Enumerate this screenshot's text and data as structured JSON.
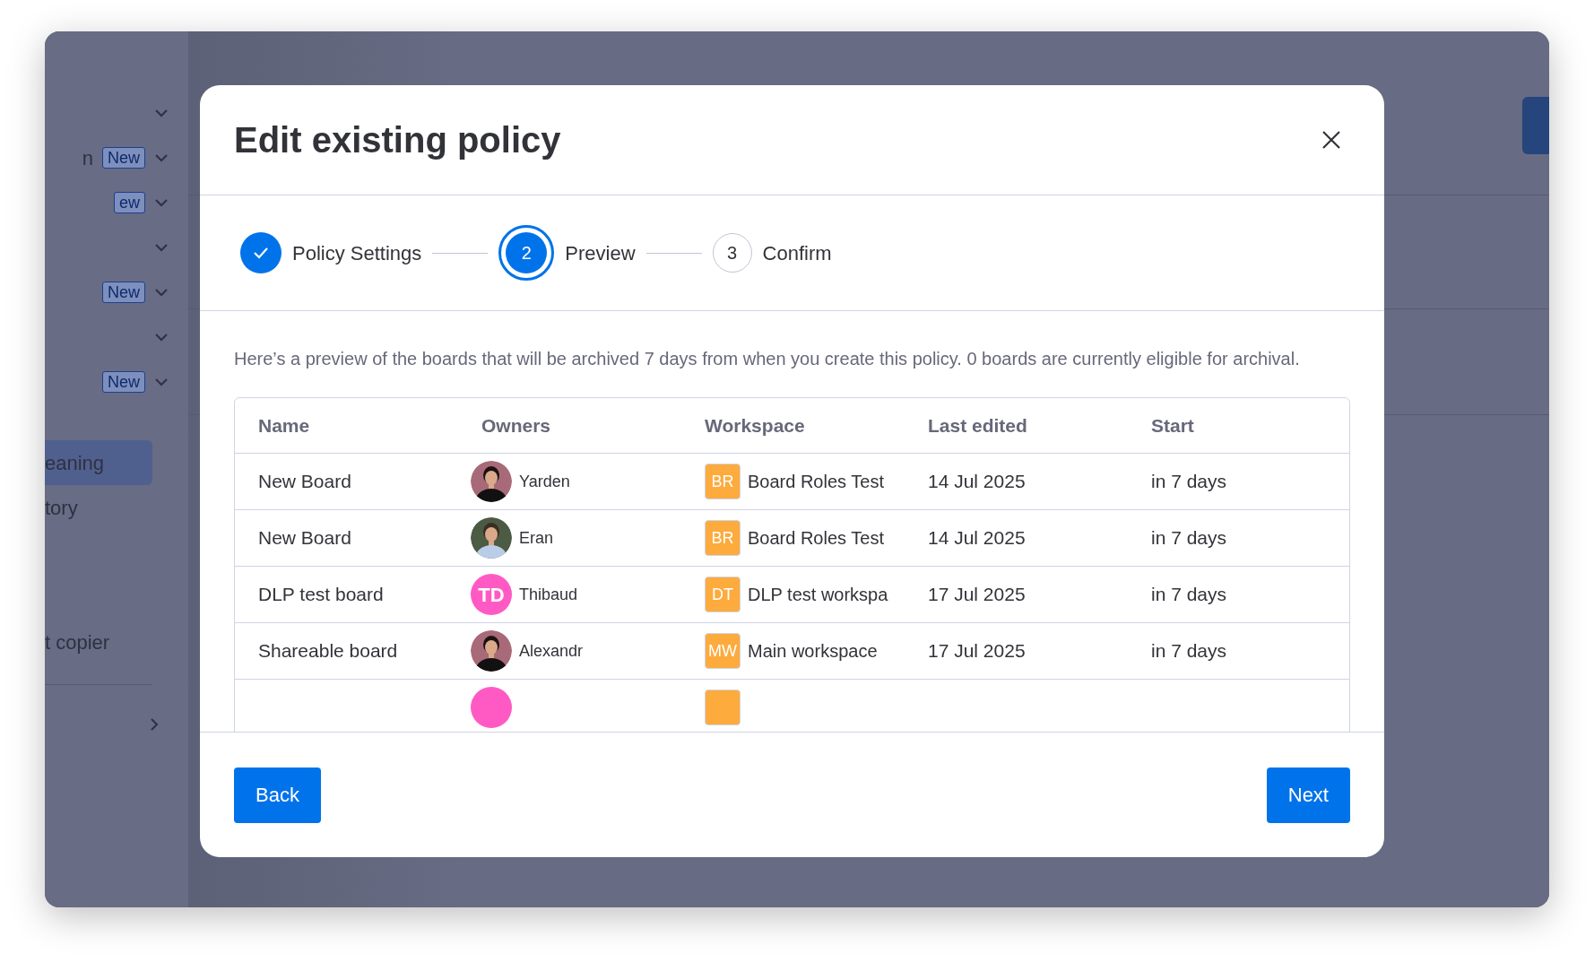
{
  "background": {
    "sections": [
      {
        "expanded": false
      },
      {
        "label": "n",
        "badge": "New",
        "expanded": false
      },
      {
        "badge": "ew",
        "expanded": false
      },
      {
        "expanded": false
      },
      {
        "badge": "New",
        "expanded": false
      },
      {
        "expanded": false
      },
      {
        "badge": "New",
        "expanded": false
      }
    ],
    "items": [
      {
        "label": "eaning",
        "selected": true
      },
      {
        "label": "tory",
        "selected": false
      },
      {
        "label": "t copier",
        "selected": false
      }
    ]
  },
  "dialog": {
    "title": "Edit existing policy",
    "steps": [
      {
        "label": "Policy Settings",
        "kind": "done"
      },
      {
        "number": "2",
        "label": "Preview",
        "kind": "current"
      },
      {
        "number": "3",
        "label": "Confirm",
        "kind": "upcoming"
      }
    ],
    "description": "Here’s a preview of the boards that will be archived 7 days from when you create this policy. 0 boards are currently eligible for archival.",
    "table": {
      "columns": [
        "Name",
        "Owners",
        "Workspace",
        "Last edited",
        "Start"
      ],
      "rows": [
        {
          "name": "New Board",
          "owner": {
            "name": "Yarden"
          },
          "workspace": {
            "badge": "BR",
            "name": "Board Roles Test"
          },
          "last_edited": "14 Jul 2025",
          "start": "in 7 days"
        },
        {
          "name": "New Board",
          "owner": {
            "name": "Eran"
          },
          "workspace": {
            "badge": "BR",
            "name": "Board Roles Test"
          },
          "last_edited": "14 Jul 2025",
          "start": "in 7 days"
        },
        {
          "name": "DLP test board",
          "owner": {
            "name": "Thibaud",
            "avatar": {
              "kind": "initials",
              "initials": "TD"
            }
          },
          "workspace": {
            "badge": "DT",
            "name": "DLP test workspa"
          },
          "last_edited": "17 Jul 2025",
          "start": "in 7 days"
        },
        {
          "name": "Shareable board",
          "owner": {
            "name": "Alexandr"
          },
          "workspace": {
            "badge": "MW",
            "name": "Main workspace"
          },
          "last_edited": "17 Jul 2025",
          "start": "in 7 days"
        },
        {
          "owner": {
            "avatar": {
              "kind": "initials"
            }
          },
          "workspace": {}
        }
      ]
    },
    "buttons": {
      "back": "Back",
      "next": "Next"
    }
  }
}
